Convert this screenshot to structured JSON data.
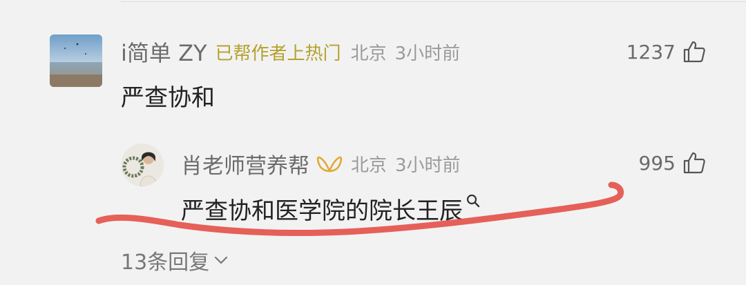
{
  "main_comment": {
    "username": "i简单 ZY",
    "hot_badge": "已帮作者上热门",
    "location": "北京",
    "time": "3小时前",
    "likes": "1237",
    "text": "严查协和"
  },
  "reply": {
    "username": "肖老师营养帮",
    "location": "北京",
    "time": "3小时前",
    "likes": "995",
    "text": "严查协和医学院的院长王辰"
  },
  "replies_toggle": {
    "label": "13条回复"
  },
  "icons": {
    "like": "thumbs-up-icon",
    "vip": "vip-butterfly-icon",
    "search": "search-icon",
    "chevron": "chevron-down-icon"
  },
  "colors": {
    "background": "#f2f2f2",
    "hot_badge": "#b4a12c",
    "vip_badge": "#e0a93a",
    "annotation": "#e4574f"
  }
}
